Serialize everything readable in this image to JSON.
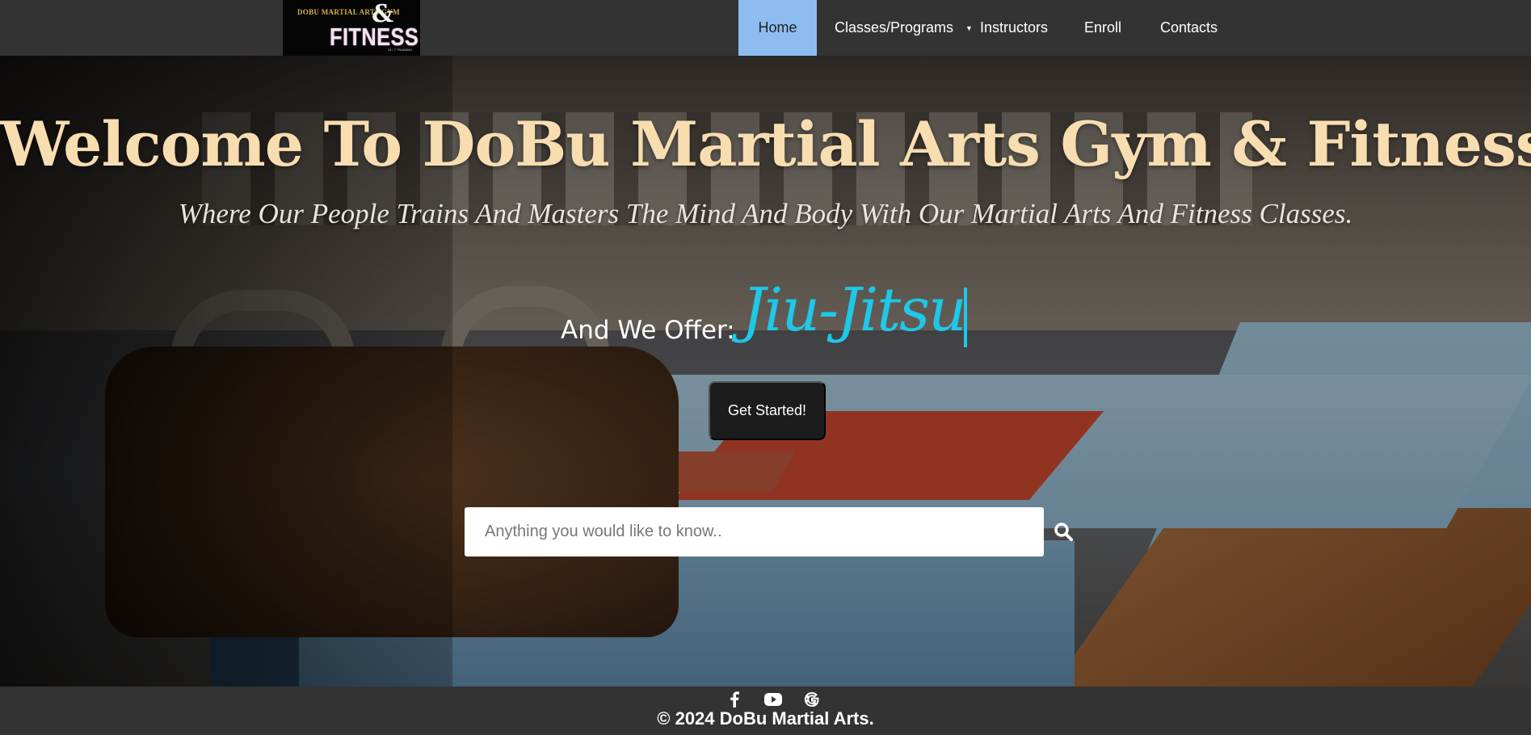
{
  "logo": {
    "line1": "DOBU MARTIAL ARTS GYM",
    "ampersand": "&",
    "word": "FITNESS",
    "tagline": "24 / 7 TRAINING"
  },
  "nav": {
    "items": [
      {
        "label": "Home",
        "active": true
      },
      {
        "label": "Classes/Programs",
        "has_dropdown": true
      },
      {
        "label": "Instructors"
      },
      {
        "label": "Enroll"
      },
      {
        "label": "Contacts"
      }
    ],
    "caret": "▼",
    "active_color": "#8dbdf0"
  },
  "hero": {
    "title": "Welcome To DoBu Martial Arts Gym & Fitness!",
    "subtitle": "Where Our People Trains And Masters The Mind And Body With Our Martial Arts And Fitness Classes.",
    "offer_label": "And We Offer:",
    "offer_value": "Jiu-Jitsu",
    "cta_label": "Get Started!",
    "title_color": "#f7ddb0",
    "offer_color": "#1ec8e8"
  },
  "search": {
    "placeholder": "Anything you would like to know..",
    "value": "",
    "icon": "search-icon"
  },
  "footer": {
    "socials": [
      "facebook-icon",
      "youtube-icon",
      "google-icon"
    ],
    "copyright": "© 2024 DoBu Martial Arts."
  }
}
